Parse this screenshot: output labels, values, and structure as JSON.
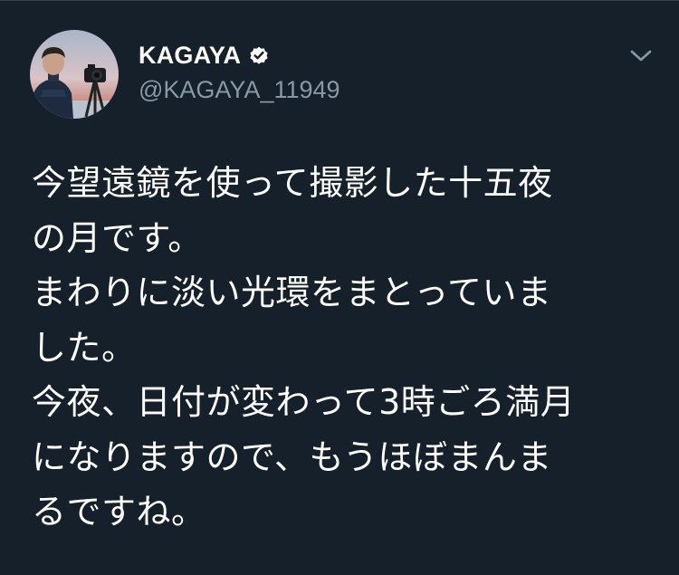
{
  "author": {
    "display_name": "KAGAYA",
    "handle": "@KAGAYA_11949",
    "verified": true
  },
  "tweet": {
    "text": "今望遠鏡を使って撮影した十五夜\nの月です。\nまわりに淡い光環をまとっていま\nした。\n今夜、日付が変わって3時ごろ満月\nになりますので、もうほぼまんま\nるですね。"
  },
  "colors": {
    "background": "#15202b",
    "text_primary": "#ffffff",
    "text_secondary": "#8899a6",
    "divider": "#38444d"
  },
  "icons": {
    "verified": "verified-badge-icon",
    "menu": "chevron-down-icon"
  }
}
